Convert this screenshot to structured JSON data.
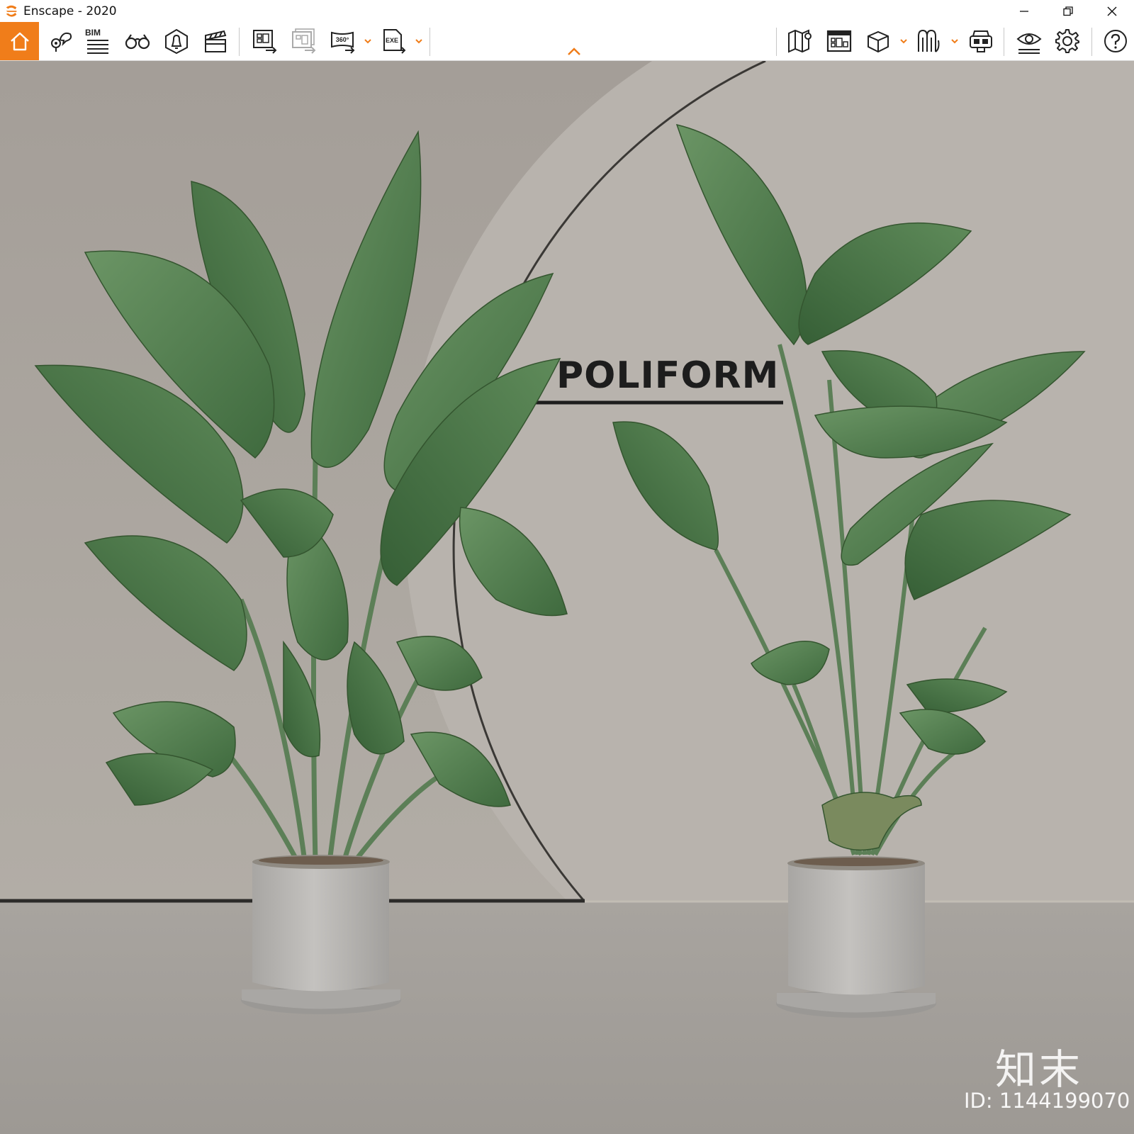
{
  "window": {
    "title": "Enscape - 2020",
    "controls": [
      "minimize",
      "restore",
      "close"
    ]
  },
  "toolbar": {
    "accent_color": "#f07d1a",
    "left_tools": [
      {
        "name": "home",
        "icon": "home-icon",
        "active": true
      },
      {
        "name": "views",
        "icon": "location-pin-icon"
      },
      {
        "name": "bim",
        "icon": "bim-info-icon",
        "label": "BIM"
      },
      {
        "name": "binoculars",
        "icon": "binoculars-icon"
      },
      {
        "name": "render-settings",
        "icon": "bell-icon"
      },
      {
        "name": "video",
        "icon": "clapperboard-icon"
      },
      {
        "name": "export-screenshot",
        "icon": "export-screenshot-icon"
      },
      {
        "name": "batch-export",
        "icon": "batch-export-icon",
        "disabled": true
      },
      {
        "name": "export-panorama",
        "icon": "panorama-360-icon",
        "label": "360°"
      },
      {
        "name": "export-exe",
        "icon": "exe-export-icon",
        "label": "EXE"
      }
    ],
    "right_tools": [
      {
        "name": "map",
        "icon": "map-icon"
      },
      {
        "name": "bim-info",
        "icon": "bim-panel-icon"
      },
      {
        "name": "asset-library",
        "icon": "cube-icon"
      },
      {
        "name": "material-editor",
        "icon": "material-icon"
      },
      {
        "name": "vr",
        "icon": "vr-headset-icon"
      },
      {
        "name": "visual-settings",
        "icon": "eye-settings-icon"
      },
      {
        "name": "settings",
        "icon": "gear-icon"
      },
      {
        "name": "help",
        "icon": "help-icon"
      }
    ]
  },
  "viewport": {
    "wall_text": "POLIFORM",
    "watermark_logo": "知末",
    "watermark_id": "ID: 1144199070",
    "wall_color": "#aba59e",
    "floor_color": "#a39f9a",
    "pot_color": "#b5b3b0",
    "leaf_color": "#4f7a4c"
  }
}
